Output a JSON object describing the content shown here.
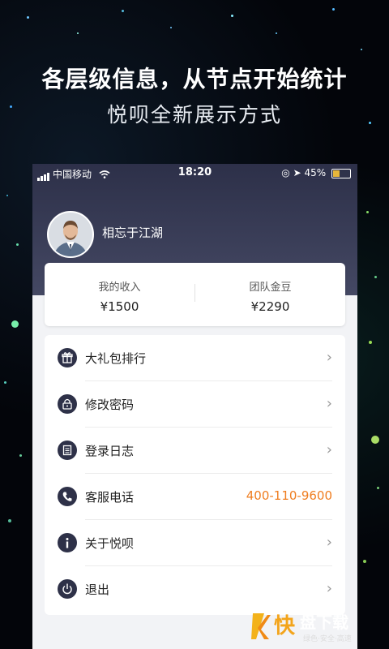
{
  "headline": "各层级信息，从节点开始统计",
  "subline": "悦呗全新展示方式",
  "status_bar": {
    "carrier": "中国移动",
    "time": "18:20",
    "battery": "45%"
  },
  "profile": {
    "name": "相忘于江湖"
  },
  "stats": [
    {
      "label": "我的收入",
      "value": "¥1500"
    },
    {
      "label": "团队金豆",
      "value": "¥2290"
    }
  ],
  "menu": [
    {
      "label": "大礼包排行",
      "icon": "gift-icon"
    },
    {
      "label": "修改密码",
      "icon": "lock-icon"
    },
    {
      "label": "登录日志",
      "icon": "log-icon"
    },
    {
      "label": "客服电话",
      "icon": "phone-icon",
      "value": "400-110-9600"
    },
    {
      "label": "关于悦呗",
      "icon": "info-icon"
    },
    {
      "label": "退出",
      "icon": "power-icon"
    }
  ],
  "colors": {
    "header_dark": "#2d3049",
    "accent_orange": "#ef7d1f",
    "icon_bg": "#2e3148"
  },
  "watermark": {
    "char": "快",
    "brand": "盘下载",
    "slogan": "绿色·安全·高速"
  }
}
